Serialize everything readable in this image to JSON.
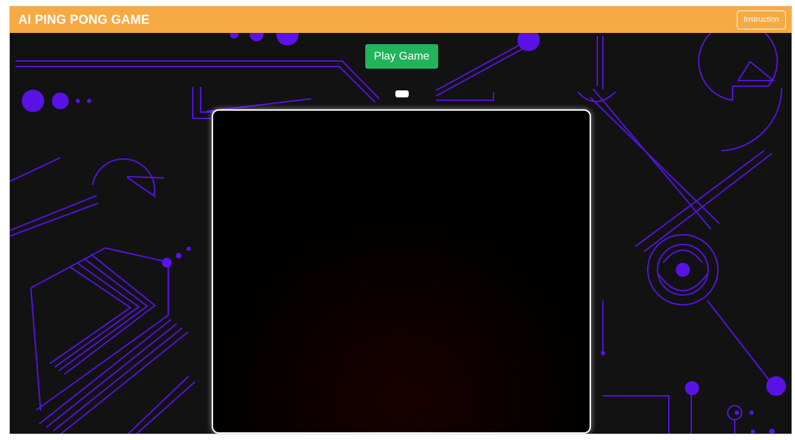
{
  "app": {
    "title": "AI PING PONG GAME"
  },
  "toolbar": {
    "instruction_label": "Instruction",
    "play_label": "Play Game"
  },
  "theme": {
    "accent": "#f7aa43",
    "play_button": "#23b35b",
    "background": "#121212",
    "line_art": "#5a12e6",
    "board": "#000000",
    "board_border": "#ffffff"
  },
  "icons": {
    "paddle": "paddle-icon"
  }
}
